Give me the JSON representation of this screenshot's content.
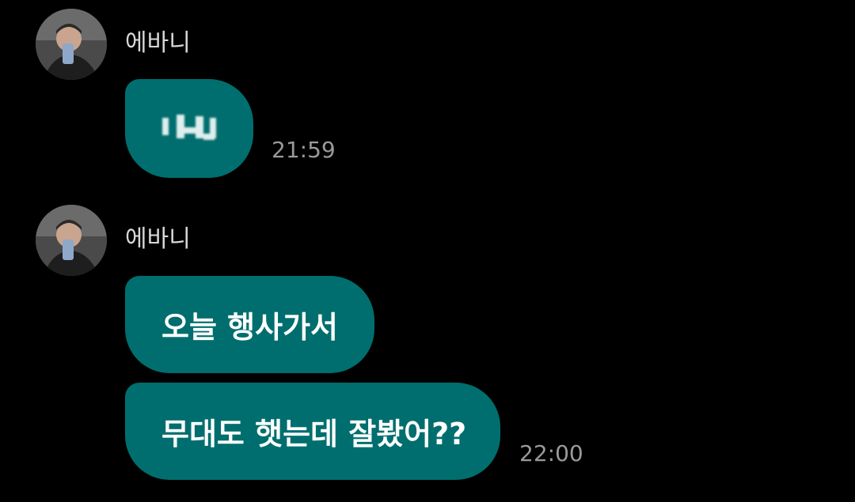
{
  "messages": [
    {
      "sender": "에바니",
      "bubbles": [
        {
          "text": "",
          "redacted": true
        }
      ],
      "time": "21:59"
    },
    {
      "sender": "에바니",
      "bubbles": [
        {
          "text": "오늘 행사가서"
        },
        {
          "text": "무대도 햇는데 잘봤어??"
        }
      ],
      "time": "22:00"
    }
  ],
  "colors": {
    "background": "#000000",
    "bubble": "#006e6e",
    "bubble_text": "#ffffff",
    "sender_text": "#d8d8d8",
    "timestamp_text": "#9a9a9a"
  },
  "icons": {
    "avatar": "profile-photo-avatar",
    "redacted": "pixelated-blur"
  }
}
